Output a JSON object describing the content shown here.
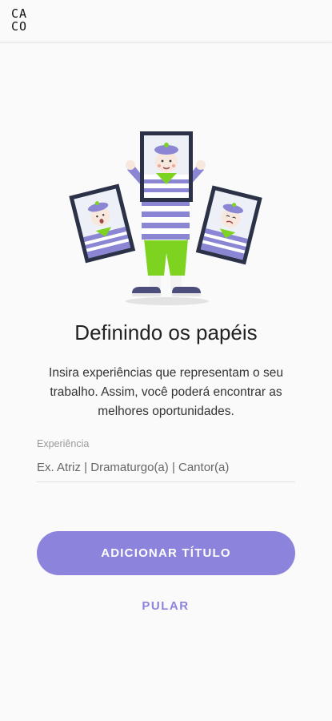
{
  "header": {
    "logo_text": "CACO",
    "logo_top": "CA",
    "logo_bottom": "CO"
  },
  "illustration": {
    "icon": "mime-with-picture-frames-illustration"
  },
  "content": {
    "title": "Definindo os papéis",
    "description": "Insira experiências que representam o seu trabalho. Assim, você poderá encontrar as melhores oportunidades."
  },
  "form": {
    "experience_label": "Experiência",
    "experience_placeholder": "Ex. Atriz | Dramaturgo(a) | Cantor(a)",
    "experience_value": ""
  },
  "actions": {
    "add_title_label": "ADICIONAR TÍTULO",
    "skip_label": "PULAR"
  },
  "colors": {
    "accent": "#8c84dc",
    "stripe": "#8a86d4",
    "pants": "#7ed321",
    "frame": "#2b3247"
  }
}
